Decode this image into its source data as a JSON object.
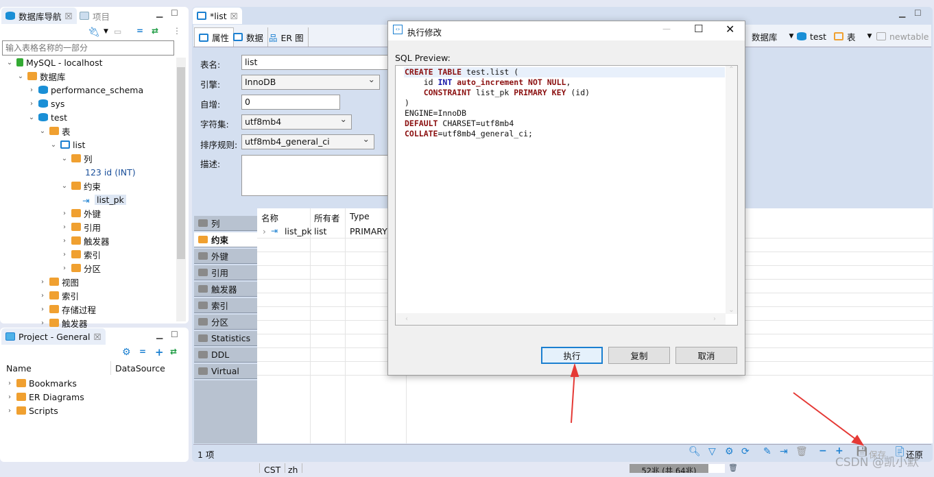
{
  "navigator": {
    "tabs": [
      {
        "label": "数据库导航",
        "active": true
      },
      {
        "label": "项目",
        "active": false
      }
    ],
    "filter_placeholder": "输入表格名称的一部分",
    "tree": [
      {
        "label": "MySQL - localhost",
        "level": 0,
        "icon": "mysql-connection-icon",
        "expanded": true
      },
      {
        "label": "数据库",
        "level": 1,
        "icon": "folder-db-icon",
        "expanded": true
      },
      {
        "label": "performance_schema",
        "level": 2,
        "icon": "database-icon",
        "expanded": false
      },
      {
        "label": "sys",
        "level": 2,
        "icon": "database-icon",
        "expanded": false
      },
      {
        "label": "test",
        "level": 2,
        "icon": "database-icon",
        "expanded": true
      },
      {
        "label": "表",
        "level": 3,
        "icon": "tables-folder-icon",
        "expanded": true
      },
      {
        "label": "list",
        "level": 4,
        "icon": "table-icon",
        "expanded": true
      },
      {
        "label": "列",
        "level": 5,
        "icon": "columns-folder-icon",
        "expanded": true
      },
      {
        "label": "123 id (INT)",
        "level": 6,
        "icon": "column-icon"
      },
      {
        "label": "约束",
        "level": 5,
        "icon": "constraints-folder-icon",
        "expanded": true
      },
      {
        "label": "list_pk",
        "level": 6,
        "icon": "primary-key-icon",
        "selected": true
      },
      {
        "label": "外键",
        "level": 5,
        "icon": "folder-icon",
        "expanded": false
      },
      {
        "label": "引用",
        "level": 5,
        "icon": "folder-icon",
        "expanded": false
      },
      {
        "label": "触发器",
        "level": 5,
        "icon": "folder-icon",
        "expanded": false
      },
      {
        "label": "索引",
        "level": 5,
        "icon": "folder-icon",
        "expanded": false
      },
      {
        "label": "分区",
        "level": 5,
        "icon": "folder-icon",
        "expanded": false
      },
      {
        "label": "视图",
        "level": 3,
        "icon": "views-folder-icon",
        "expanded": false
      },
      {
        "label": "索引",
        "level": 3,
        "icon": "folder-icon",
        "expanded": false
      },
      {
        "label": "存储过程",
        "level": 3,
        "icon": "folder-icon",
        "expanded": false
      },
      {
        "label": "触发器",
        "level": 3,
        "icon": "folder-icon",
        "expanded": false
      }
    ]
  },
  "project": {
    "tab": "Project - General",
    "columns": [
      "Name",
      "DataSource"
    ],
    "items": [
      "Bookmarks",
      "ER Diagrams",
      "Scripts"
    ]
  },
  "editor": {
    "tab": "*list",
    "subtabs": [
      "属性",
      "数据",
      "ER 图"
    ],
    "toolbar": {
      "db_label": "数据库",
      "schema": "test",
      "tables_label": "表",
      "new_table": "newtable"
    },
    "fields": {
      "name_label": "表名:",
      "name": "list",
      "engine_label": "引擎:",
      "engine": "InnoDB",
      "autoinc_label": "自增:",
      "autoinc": "0",
      "charset_label": "字符集:",
      "charset": "utf8mb4",
      "collation_label": "排序规则:",
      "collation": "utf8mb4_general_ci",
      "desc_label": "描述:"
    },
    "side_tabs": [
      "列",
      "约束",
      "外键",
      "引用",
      "触发器",
      "索引",
      "分区",
      "Statistics",
      "DDL",
      "Virtual"
    ],
    "active_side_tab": "约束",
    "table": {
      "columns": [
        "名称",
        "所有者",
        "Type"
      ],
      "rows": [
        [
          "list_pk",
          "list",
          "PRIMARY"
        ]
      ]
    },
    "status": "1 项",
    "save_label": "保存",
    "revert_label": "还原"
  },
  "statusbar": {
    "tz": "CST",
    "locale": "zh",
    "memory": "52兆 (共 64兆)"
  },
  "dialog": {
    "title": "执行修改",
    "preview_label": "SQL Preview:",
    "sql": [
      [
        [
          "kw",
          "CREATE TABLE"
        ],
        [
          "t",
          " test.list ("
        ]
      ],
      [
        [
          "t",
          "    id "
        ],
        [
          "ty",
          "INT"
        ],
        [
          "t",
          " "
        ],
        [
          "kw",
          "auto_increment NOT NULL"
        ],
        [
          "t",
          ","
        ]
      ],
      [
        [
          "t",
          "    "
        ],
        [
          "kw",
          "CONSTRAINT"
        ],
        [
          "t",
          " list_pk "
        ],
        [
          "kw",
          "PRIMARY KEY"
        ],
        [
          "t",
          " (id)"
        ]
      ],
      [
        [
          "t",
          ")"
        ]
      ],
      [
        [
          "t",
          "ENGINE=InnoDB"
        ]
      ],
      [
        [
          "kw",
          "DEFAULT"
        ],
        [
          "t",
          " CHARSET=utf8mb4"
        ]
      ],
      [
        [
          "kw",
          "COLLATE"
        ],
        [
          "t",
          "=utf8mb4_general_ci;"
        ]
      ]
    ],
    "buttons": {
      "execute": "执行",
      "copy": "复制",
      "cancel": "取消"
    }
  },
  "watermark": "CSDN @凯小默",
  "colors": {
    "accent": "#1a7fd0",
    "arrow": "#e53935",
    "keyword": "#8b1010",
    "type": "#1a1aa8"
  }
}
